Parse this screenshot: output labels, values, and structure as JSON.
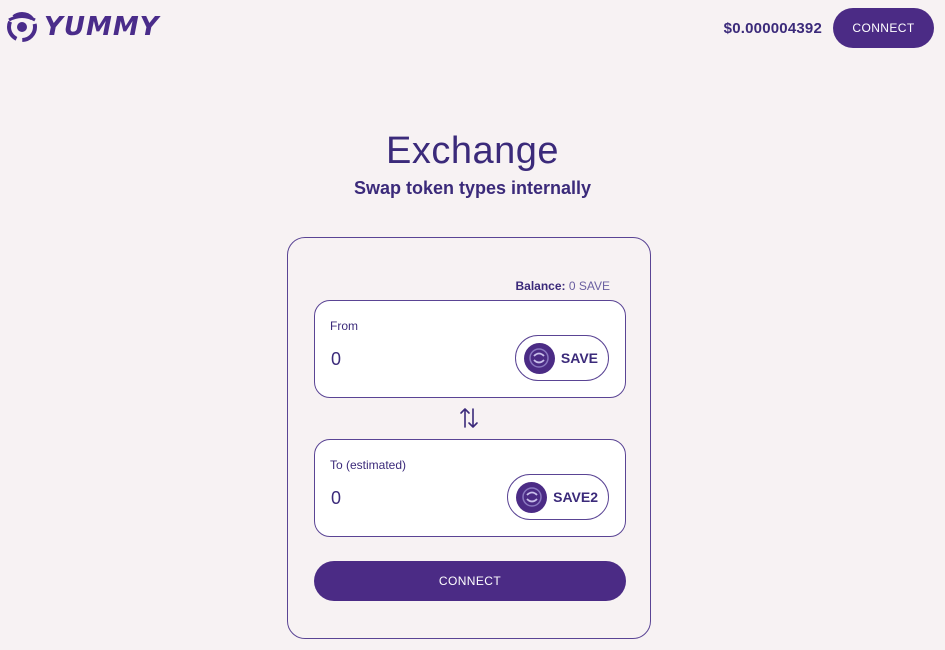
{
  "header": {
    "brand": "YUMMY",
    "logo_icon": "yummy-swirl-icon",
    "price": "$0.000004392",
    "connect_label": "CONNECT"
  },
  "hero": {
    "title": "Exchange",
    "subtitle": "Swap token types internally"
  },
  "exchange": {
    "balance_label": "Balance:",
    "balance_value": "0 SAVE",
    "from": {
      "label": "From",
      "value": "0",
      "token": "SAVE",
      "token_icon": "save-token-icon"
    },
    "swap_icon": "swap-arrows-icon",
    "to": {
      "label": "To (estimated)",
      "value": "0",
      "token": "SAVE2",
      "token_icon": "save2-token-icon"
    },
    "connect_label": "CONNECT"
  },
  "colors": {
    "background": "#f7f2f3",
    "accent": "#4b2b85",
    "text": "#3b2a7a"
  }
}
